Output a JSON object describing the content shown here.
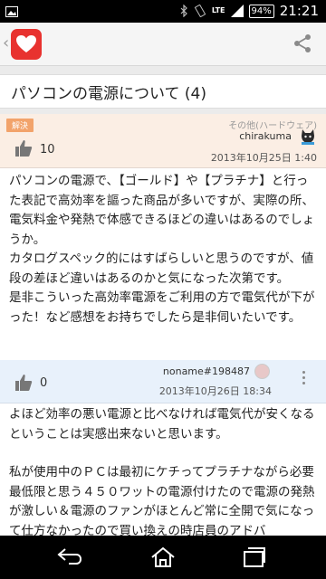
{
  "status_bar": {
    "time": "21:21",
    "battery": "94%",
    "network": "LTE",
    "icons": [
      "image-icon",
      "bluetooth-icon",
      "vibrate-icon",
      "signal-icon",
      "battery-icon"
    ]
  },
  "app_bar": {
    "logo_icon": "heart-icon",
    "back_icon": "chevron-left-icon",
    "share_icon": "share-icon",
    "brand_color": "#e8322f"
  },
  "thread": {
    "title": "パソコンの電源について (4)",
    "status_badge": "解決",
    "category": "その他(ハードウェア)"
  },
  "posts": [
    {
      "likes": "10",
      "user": "chirakuma",
      "date": "2013年10月25日 1:40",
      "body": "パソコンの電源で、【ゴールド】や【プラチナ】と行った表記で高効率を謳った商品が多いですが、実際の所、電気料金や発熱で体感できるほどの違いはあるのでしょうか。\nカタログスペック的にはすばらしいと思うのですが、値段の差ほど違いはあるのかと気になった次第です。\n是非こういった高効率電源をご利用の方で電気代が下がった！など感想をお持ちでしたら是非伺いたいです。"
    },
    {
      "likes": "0",
      "user": "noname#198487",
      "date": "2013年10月26日 18:34",
      "paragraph_1": "よほど効率の悪い電源と比べなければ電気代が安くなるということは実感出来ないと思います。",
      "paragraph_2": "私が使用中のＰＣは最初にケチってプラチナながら必要最低限と思う４５０ワットの電源付けたので電源の発熱が激しい＆電源のファンがほとんど常に全開で気になって仕方なかったので買い換えの時店員のアドバ"
    }
  ],
  "nav_bar": {
    "icons": [
      "back-icon",
      "home-icon",
      "recents-icon"
    ]
  }
}
